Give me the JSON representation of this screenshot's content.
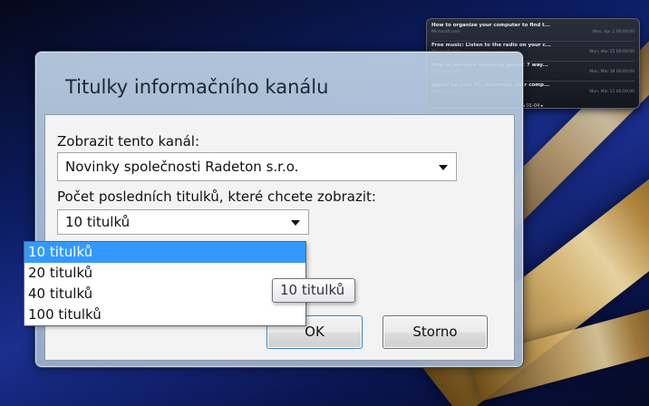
{
  "gadget": {
    "items": [
      {
        "title": "How to organize your computer to find t...",
        "source": "Microsoft.com",
        "date": "Mon, Apr 1 00:00:00"
      },
      {
        "title": "Free music: Listen to the radio on your c...",
        "source": "Microsoft.com",
        "date": "Mon, Mar 25 00:00:00"
      },
      {
        "title": "How to increase browsing speed: 7 way...",
        "source": "Microsoft.com",
        "date": "Mon, Mar 18 00:00:00"
      },
      {
        "title": "Speed up your PC: Automate your comp...",
        "source": "Microsoft.com",
        "date": "Mon, Mar 11 00:00:00"
      }
    ],
    "nav": "◂  01-04  ▸"
  },
  "dialog": {
    "title": "Titulky informačního kanálu",
    "channel_label": "Zobrazit tento kanál:",
    "channel_value": "Novinky společnosti Radeton s.r.o.",
    "count_label": "Počet posledních titulků, které chcete zobrazit:",
    "count_value": "10 titulků",
    "count_options": [
      "10 titulků",
      "20 titulků",
      "40 titulků",
      "100 titulků"
    ],
    "tooltip": "10 titulků",
    "ok_label": "OK",
    "cancel_label": "Storno"
  }
}
